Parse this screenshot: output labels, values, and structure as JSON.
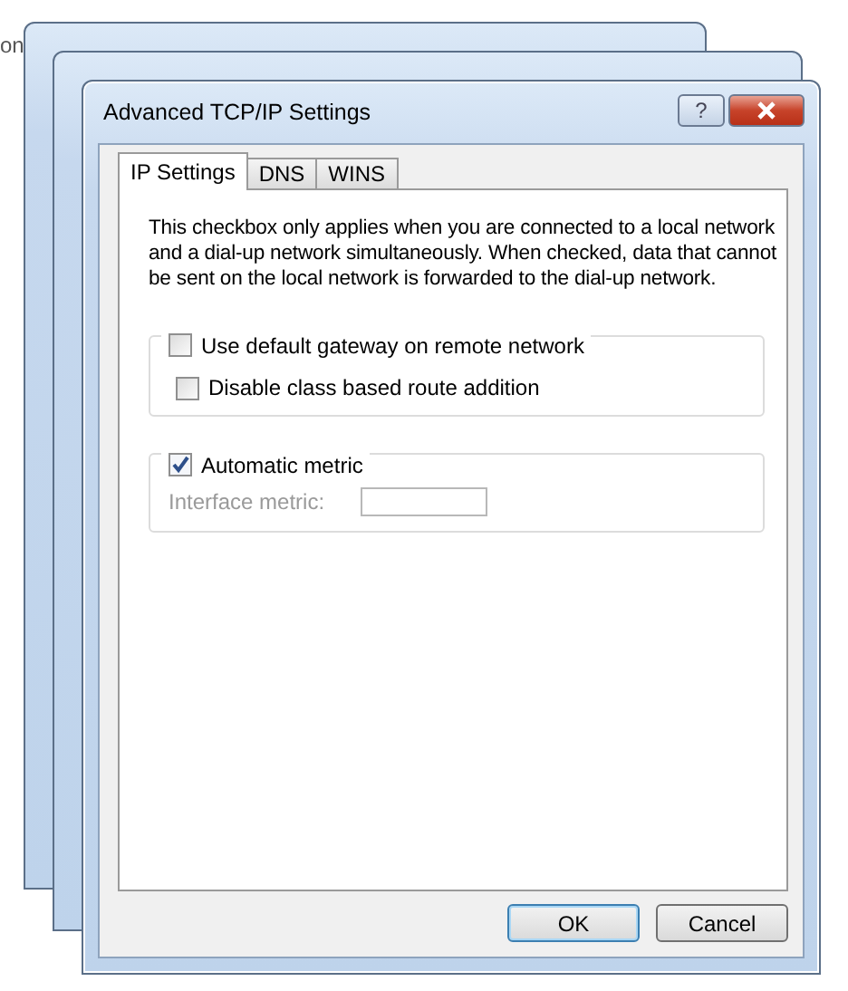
{
  "background_text": "on",
  "window": {
    "title": "Advanced TCP/IP Settings",
    "help_button": "?"
  },
  "tabs": [
    {
      "label": "IP Settings",
      "selected": true
    },
    {
      "label": "DNS",
      "selected": false
    },
    {
      "label": "WINS",
      "selected": false
    }
  ],
  "description": "This checkbox only applies when you are connected to a local network and a dial-up network simultaneously.  When checked, data that cannot be sent on the local network is forwarded to the dial-up network.",
  "groups": [
    {
      "header": {
        "label": "Use default gateway on remote network",
        "checked": false
      },
      "checkboxes": [
        {
          "label": "Disable class based route addition",
          "checked": false
        }
      ]
    },
    {
      "header": {
        "label": "Automatic metric",
        "checked": true
      },
      "field": {
        "label": "Interface metric:",
        "disabled": true
      }
    }
  ],
  "buttons": [
    {
      "label": "OK",
      "default": true
    },
    {
      "label": "Cancel",
      "default": false
    }
  ]
}
